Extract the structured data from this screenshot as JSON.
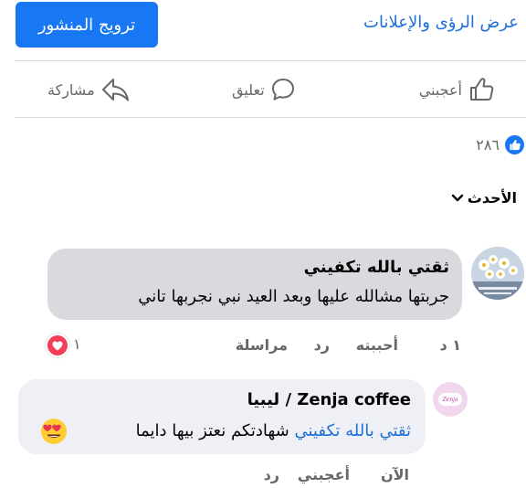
{
  "header": {
    "promote_label": "ترويج المنشور",
    "insights_label": "عرض الرؤى والإعلانات"
  },
  "actions": {
    "like_label": "أعجبني",
    "comment_label": "تعليق",
    "share_label": "مشاركة"
  },
  "reactions": {
    "count": "٢٨٦",
    "icon": "like-icon"
  },
  "sort": {
    "label": "الأحدث",
    "icon": "chevron-down-icon"
  },
  "comments": [
    {
      "author": "ثقتي بالله تكفيني",
      "text": "جربتها مشالله عليها وبعد العيد نبي نجربها تاني",
      "time": "١ د",
      "loved_label": "أحببته",
      "reply_label": "رد",
      "message_label": "مراسلة",
      "reaction_count": "١",
      "reaction_icon": "heart-icon"
    },
    {
      "author": "Zenja coffee / ليبيا",
      "mention": "ثقتي بالله تكفيني",
      "text": "شهادتكم نعتز بيها دايما",
      "emoji": "heart-eyes-emoji",
      "time": "الآن",
      "like_label": "أعجبني",
      "reply_label": "رد"
    }
  ],
  "colors": {
    "brand_blue": "#1877f2",
    "link_blue": "#1d6fd8",
    "bubble_gray": "#d9dadd",
    "bubble_light": "#eef0f5",
    "love_red": "#e41e3f",
    "heart_badge": "#f33e58",
    "muted_text": "#65676b"
  }
}
